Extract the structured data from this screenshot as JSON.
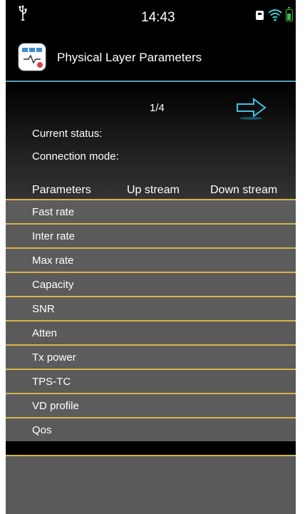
{
  "status_bar": {
    "time": "14:43",
    "icons": [
      "usb-icon",
      "sim-card-icon",
      "wifi-icon",
      "battery-icon"
    ]
  },
  "title_bar": {
    "app_icon": "physical-layer-app-icon",
    "title": "Physical Layer Parameters"
  },
  "pager": {
    "indicator": "1/4",
    "next_icon": "right-arrow-icon"
  },
  "status": {
    "current_status_label": "Current status:",
    "connection_mode_label": "Connection mode:"
  },
  "table": {
    "headers": [
      "Parameters",
      "Up stream",
      "Down stream"
    ],
    "rows": [
      {
        "label": "Fast rate"
      },
      {
        "label": "Inter rate"
      },
      {
        "label": "Max rate"
      },
      {
        "label": "Capacity"
      },
      {
        "label": "SNR"
      },
      {
        "label": "Atten"
      },
      {
        "label": "Tx power"
      },
      {
        "label": "TPS-TC"
      },
      {
        "label": "VD profile"
      },
      {
        "label": "Qos"
      }
    ]
  },
  "colors": {
    "accent_divider": "#4fa0b8",
    "row_separator": "#d6b44a",
    "row_background": "#5a5a5a",
    "arrow": "#3fc3e6"
  }
}
